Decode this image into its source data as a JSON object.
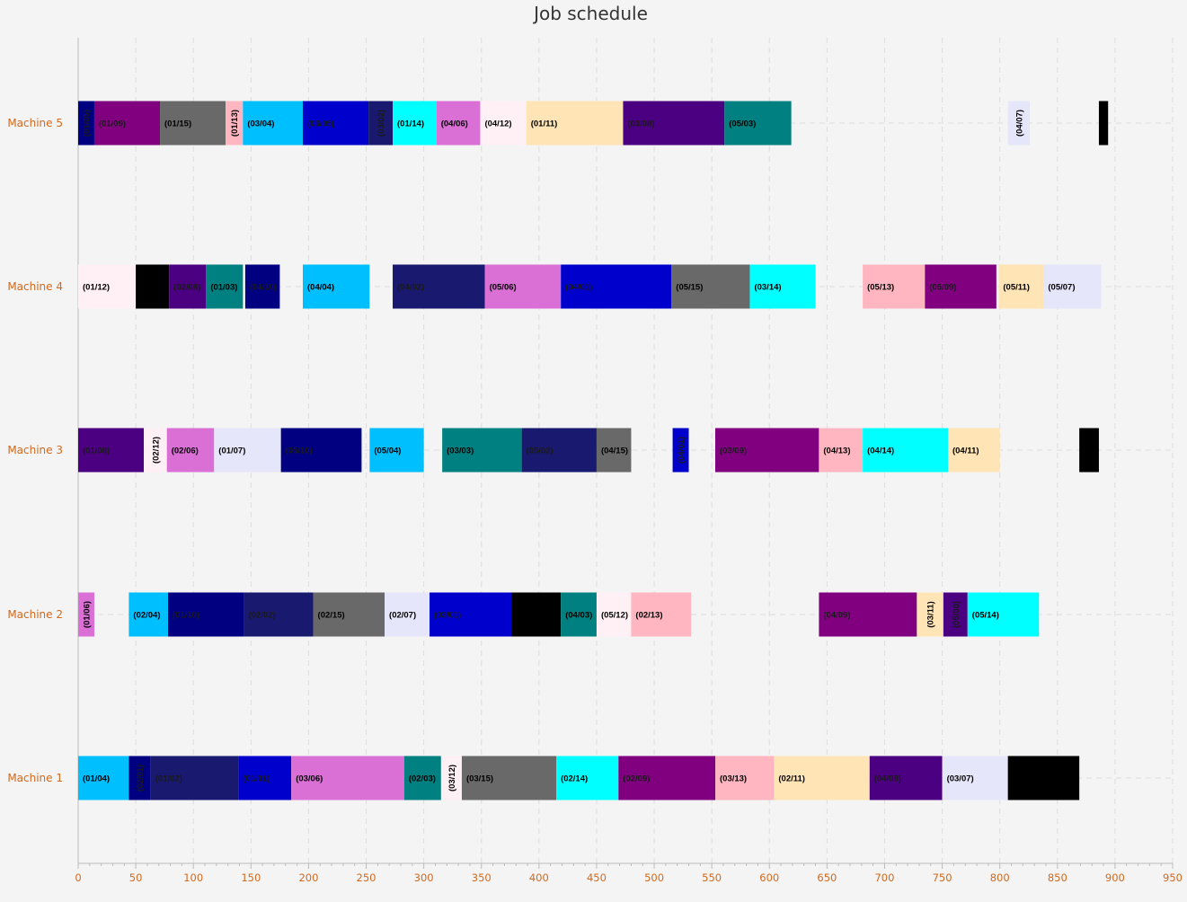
{
  "chart_data": {
    "type": "gantt",
    "title": "Job schedule",
    "xlabel": "",
    "ylabel": "",
    "xlim": [
      0,
      950
    ],
    "x_ticks": [
      0,
      50,
      100,
      150,
      200,
      250,
      300,
      350,
      400,
      450,
      500,
      550,
      600,
      650,
      700,
      750,
      800,
      850,
      900,
      950
    ],
    "grid": true,
    "categories": [
      "Machine 1",
      "Machine 2",
      "Machine 3",
      "Machine 4",
      "Machine 5"
    ],
    "job_colors": {
      "01": "#00bfff",
      "02": "#000080",
      "03": "#ffffff",
      "04": "#00bfff",
      "05": "#00008b"
    },
    "tasks": [
      {
        "machine": "Machine 1",
        "label": "(01/04)",
        "start": 0,
        "end": 44,
        "color": "#00bfff"
      },
      {
        "machine": "Machine 1",
        "label": "(02/01)",
        "start": 44,
        "end": 63,
        "color": "#000080",
        "vertical": true
      },
      {
        "machine": "Machine 1",
        "label": "(01/02)",
        "start": 63,
        "end": 139,
        "color": "#191970"
      },
      {
        "machine": "Machine 1",
        "label": "(01/01)",
        "start": 139,
        "end": 185,
        "color": "#0000cd"
      },
      {
        "machine": "Machine 1",
        "label": "(03/06)",
        "start": 185,
        "end": 283,
        "color": "#da70d6"
      },
      {
        "machine": "Machine 1",
        "label": "(02/03)",
        "start": 283,
        "end": 315,
        "color": "#008080"
      },
      {
        "machine": "Machine 1",
        "label": "(03/12)",
        "start": 315,
        "end": 333,
        "color": "#fff0f5",
        "vertical": true
      },
      {
        "machine": "Machine 1",
        "label": "(03/15)",
        "start": 333,
        "end": 415,
        "color": "#696969"
      },
      {
        "machine": "Machine 1",
        "label": "(02/14)",
        "start": 415,
        "end": 469,
        "color": "#00ffff"
      },
      {
        "machine": "Machine 1",
        "label": "(02/09)",
        "start": 469,
        "end": 553,
        "color": "#800080"
      },
      {
        "machine": "Machine 1",
        "label": "(03/13)",
        "start": 553,
        "end": 604,
        "color": "#ffb6c1"
      },
      {
        "machine": "Machine 1",
        "label": "(02/11)",
        "start": 604,
        "end": 687,
        "color": "#ffe4b5"
      },
      {
        "machine": "Machine 1",
        "label": "(04/08)",
        "start": 687,
        "end": 750,
        "color": "#4b0082"
      },
      {
        "machine": "Machine 1",
        "label": "(03/07)",
        "start": 750,
        "end": 807,
        "color": "#e6e6fa"
      },
      {
        "machine": "Machine 1",
        "label": "",
        "start": 807,
        "end": 869,
        "color": "#000000"
      },
      {
        "machine": "Machine 2",
        "label": "(01/06)",
        "start": 0,
        "end": 14,
        "color": "#da70d6",
        "vertical": true
      },
      {
        "machine": "Machine 2",
        "label": "(02/04)",
        "start": 44,
        "end": 78,
        "color": "#00bfff"
      },
      {
        "machine": "Machine 2",
        "label": "(01/10)",
        "start": 78,
        "end": 144,
        "color": "#000080"
      },
      {
        "machine": "Machine 2",
        "label": "(02/02)",
        "start": 144,
        "end": 204,
        "color": "#191970"
      },
      {
        "machine": "Machine 2",
        "label": "(02/15)",
        "start": 204,
        "end": 266,
        "color": "#696969"
      },
      {
        "machine": "Machine 2",
        "label": "(02/07)",
        "start": 266,
        "end": 305,
        "color": "#e6e6fa"
      },
      {
        "machine": "Machine 2",
        "label": "(03/01)",
        "start": 305,
        "end": 376,
        "color": "#0000cd"
      },
      {
        "machine": "Machine 2",
        "label": "",
        "start": 376,
        "end": 419,
        "color": "#000000"
      },
      {
        "machine": "Machine 2",
        "label": "(04/03)",
        "start": 419,
        "end": 450,
        "color": "#008080"
      },
      {
        "machine": "Machine 2",
        "label": "(05/12)",
        "start": 450,
        "end": 480,
        "color": "#fff0f5"
      },
      {
        "machine": "Machine 2",
        "label": "(02/13)",
        "start": 480,
        "end": 532,
        "color": "#ffb6c1"
      },
      {
        "machine": "Machine 2",
        "label": "(04/09)",
        "start": 643,
        "end": 728,
        "color": "#800080"
      },
      {
        "machine": "Machine 2",
        "label": "(03/11)",
        "start": 728,
        "end": 751,
        "color": "#ffe4b5",
        "vertical": true
      },
      {
        "machine": "Machine 2",
        "label": "(05/08)",
        "start": 751,
        "end": 772,
        "color": "#4b0082",
        "vertical": true
      },
      {
        "machine": "Machine 2",
        "label": "(05/14)",
        "start": 772,
        "end": 834,
        "color": "#00ffff"
      },
      {
        "machine": "Machine 3",
        "label": "(01/08)",
        "start": 0,
        "end": 57,
        "color": "#4b0082"
      },
      {
        "machine": "Machine 3",
        "label": "(02/12)",
        "start": 57,
        "end": 77,
        "color": "#fff0f5",
        "vertical": true
      },
      {
        "machine": "Machine 3",
        "label": "(02/06)",
        "start": 77,
        "end": 118,
        "color": "#da70d6"
      },
      {
        "machine": "Machine 3",
        "label": "(01/07)",
        "start": 118,
        "end": 176,
        "color": "#e6e6fa"
      },
      {
        "machine": "Machine 3",
        "label": "(05/10)",
        "start": 176,
        "end": 246,
        "color": "#000080"
      },
      {
        "machine": "Machine 3",
        "label": "(05/04)",
        "start": 253,
        "end": 300,
        "color": "#00bfff"
      },
      {
        "machine": "Machine 3",
        "label": "(03/03)",
        "start": 316,
        "end": 385,
        "color": "#008080"
      },
      {
        "machine": "Machine 3",
        "label": "(05/02)",
        "start": 385,
        "end": 450,
        "color": "#191970"
      },
      {
        "machine": "Machine 3",
        "label": "(04/15)",
        "start": 450,
        "end": 480,
        "color": "#696969"
      },
      {
        "machine": "Machine 3",
        "label": "(04/01)",
        "start": 516,
        "end": 530,
        "color": "#0000cd",
        "vertical": true
      },
      {
        "machine": "Machine 3",
        "label": "(03/09)",
        "start": 553,
        "end": 643,
        "color": "#800080"
      },
      {
        "machine": "Machine 3",
        "label": "(04/13)",
        "start": 643,
        "end": 681,
        "color": "#ffb6c1"
      },
      {
        "machine": "Machine 3",
        "label": "(04/14)",
        "start": 681,
        "end": 755,
        "color": "#00ffff"
      },
      {
        "machine": "Machine 3",
        "label": "(04/11)",
        "start": 755,
        "end": 800,
        "color": "#ffe4b5"
      },
      {
        "machine": "Machine 3",
        "label": "",
        "start": 869,
        "end": 886,
        "color": "#000000"
      },
      {
        "machine": "Machine 4",
        "label": "(01/12)",
        "start": 0,
        "end": 50,
        "color": "#fff0f5"
      },
      {
        "machine": "Machine 4",
        "label": "",
        "start": 50,
        "end": 79,
        "color": "#000000"
      },
      {
        "machine": "Machine 4",
        "label": "(02/08)",
        "start": 79,
        "end": 111,
        "color": "#4b0082"
      },
      {
        "machine": "Machine 4",
        "label": "(01/03)",
        "start": 111,
        "end": 143,
        "color": "#008080"
      },
      {
        "machine": "Machine 4",
        "label": "(04/10)",
        "start": 145,
        "end": 175,
        "color": "#000080"
      },
      {
        "machine": "Machine 4",
        "label": "(04/04)",
        "start": 195,
        "end": 253,
        "color": "#00bfff"
      },
      {
        "machine": "Machine 4",
        "label": "(04/02)",
        "start": 273,
        "end": 353,
        "color": "#191970"
      },
      {
        "machine": "Machine 4",
        "label": "(05/06)",
        "start": 353,
        "end": 419,
        "color": "#da70d6"
      },
      {
        "machine": "Machine 4",
        "label": "(04/01)",
        "start": 419,
        "end": 515,
        "color": "#0000cd"
      },
      {
        "machine": "Machine 4",
        "label": "(05/15)",
        "start": 515,
        "end": 583,
        "color": "#696969"
      },
      {
        "machine": "Machine 4",
        "label": "(03/14)",
        "start": 583,
        "end": 640,
        "color": "#00ffff"
      },
      {
        "machine": "Machine 4",
        "label": "(05/13)",
        "start": 681,
        "end": 735,
        "color": "#ffb6c1"
      },
      {
        "machine": "Machine 4",
        "label": "(05/09)",
        "start": 735,
        "end": 797,
        "color": "#800080"
      },
      {
        "machine": "Machine 4",
        "label": "(05/11)",
        "start": 799,
        "end": 838,
        "color": "#ffe4b5"
      },
      {
        "machine": "Machine 4",
        "label": "(05/07)",
        "start": 838,
        "end": 888,
        "color": "#e6e6fa"
      },
      {
        "machine": "Machine 5",
        "label": "(01/05)",
        "start": 0,
        "end": 14,
        "color": "#000080",
        "vertical": true
      },
      {
        "machine": "Machine 5",
        "label": "(01/09)",
        "start": 14,
        "end": 71,
        "color": "#800080"
      },
      {
        "machine": "Machine 5",
        "label": "(01/15)",
        "start": 71,
        "end": 128,
        "color": "#696969"
      },
      {
        "machine": "Machine 5",
        "label": "(01/13)",
        "start": 128,
        "end": 143,
        "color": "#ffb6c1",
        "vertical": true
      },
      {
        "machine": "Machine 5",
        "label": "(03/04)",
        "start": 143,
        "end": 195,
        "color": "#00bfff"
      },
      {
        "machine": "Machine 5",
        "label": "(03/05)",
        "start": 195,
        "end": 252,
        "color": "#0000cd"
      },
      {
        "machine": "Machine 5",
        "label": "(03/02)",
        "start": 252,
        "end": 273,
        "color": "#191970",
        "vertical": true
      },
      {
        "machine": "Machine 5",
        "label": "(01/14)",
        "start": 273,
        "end": 311,
        "color": "#00ffff"
      },
      {
        "machine": "Machine 5",
        "label": "(04/06)",
        "start": 311,
        "end": 349,
        "color": "#da70d6"
      },
      {
        "machine": "Machine 5",
        "label": "(04/12)",
        "start": 349,
        "end": 389,
        "color": "#fff0f5"
      },
      {
        "machine": "Machine 5",
        "label": "(01/11)",
        "start": 389,
        "end": 473,
        "color": "#ffe4b5"
      },
      {
        "machine": "Machine 5",
        "label": "(03/08)",
        "start": 473,
        "end": 561,
        "color": "#4b0082"
      },
      {
        "machine": "Machine 5",
        "label": "(05/03)",
        "start": 561,
        "end": 619,
        "color": "#008080"
      },
      {
        "machine": "Machine 5",
        "label": "(04/07)",
        "start": 807,
        "end": 826,
        "color": "#e6e6fa",
        "vertical": true
      },
      {
        "machine": "Machine 5",
        "label": "",
        "start": 886,
        "end": 894,
        "color": "#000000"
      }
    ]
  }
}
